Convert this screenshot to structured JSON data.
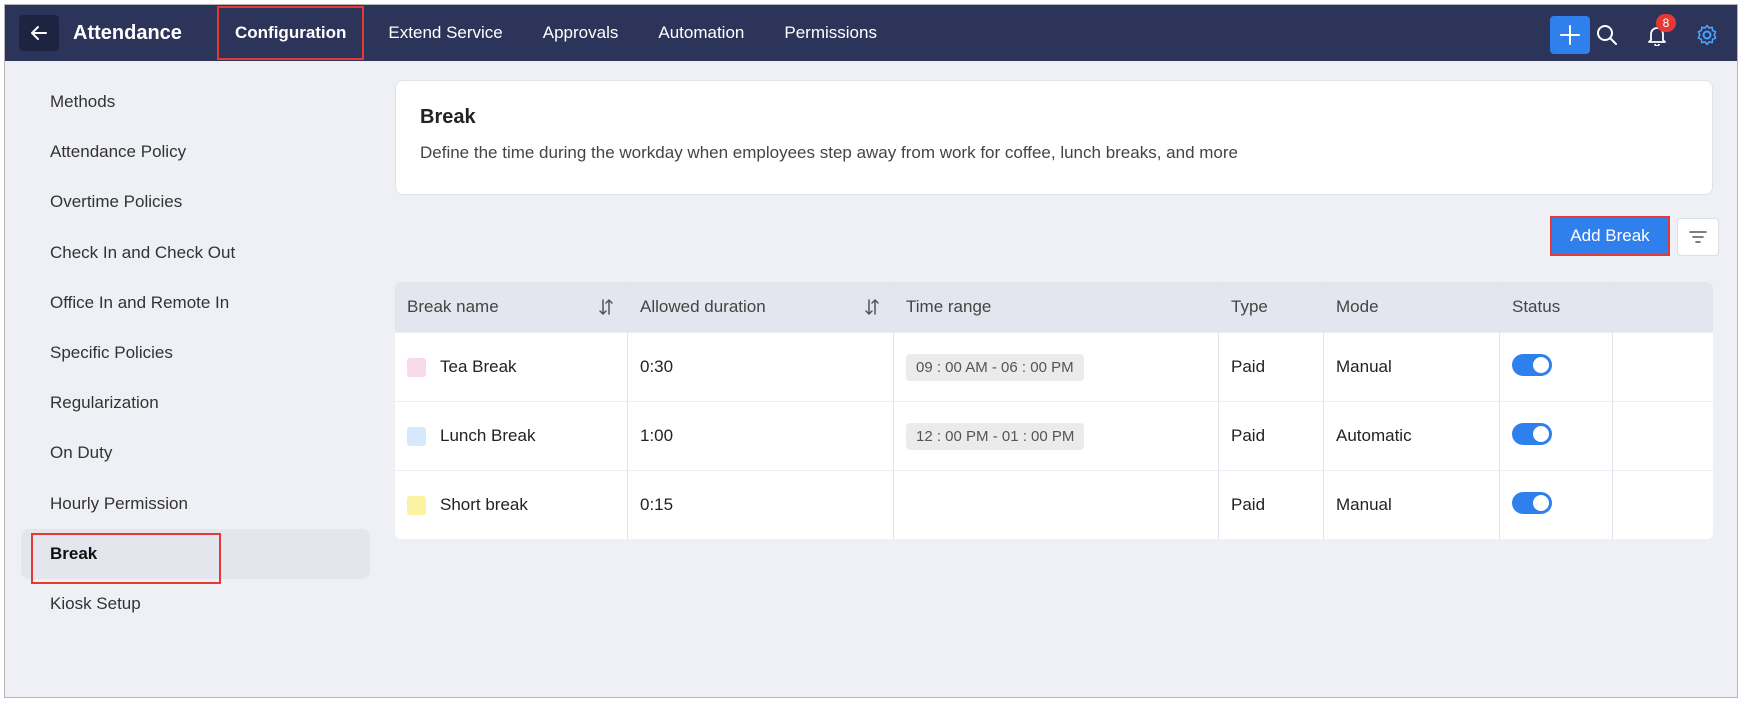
{
  "header": {
    "app_title": "Attendance",
    "nav": [
      "Configuration",
      "Extend Service",
      "Approvals",
      "Automation",
      "Permissions"
    ],
    "notification_count": "8",
    "accent_color": "#2f80ed",
    "bar_color": "#2c3459"
  },
  "sidebar": {
    "items": [
      "Methods",
      "Attendance Policy",
      "Overtime Policies",
      "Check In and Check Out",
      "Office In and Remote In",
      "Specific Policies",
      "Regularization",
      "On Duty",
      "Hourly Permission",
      "Break",
      "Kiosk Setup"
    ],
    "active": "Break"
  },
  "info": {
    "title": "Break",
    "description": "Define the time during the workday when employees step away from work for coffee, lunch breaks, and more"
  },
  "actions": {
    "add_label": "Add Break"
  },
  "table": {
    "headers": [
      "Break name",
      "Allowed duration",
      "Time range",
      "Type",
      "Mode",
      "Status",
      ""
    ],
    "rows": [
      {
        "name": "Tea Break",
        "color": "#f7d9ea",
        "duration": "0:30",
        "time_range": "09 : 00 AM - 06 : 00 PM",
        "type": "Paid",
        "mode": "Manual",
        "status_on": true
      },
      {
        "name": "Lunch Break",
        "color": "#d6e8fb",
        "duration": "1:00",
        "time_range": "12 : 00 PM - 01 : 00 PM",
        "type": "Paid",
        "mode": "Automatic",
        "status_on": true
      },
      {
        "name": "Short break",
        "color": "#fbf3a3",
        "duration": "0:15",
        "time_range": "",
        "type": "Paid",
        "mode": "Manual",
        "status_on": true
      }
    ]
  }
}
